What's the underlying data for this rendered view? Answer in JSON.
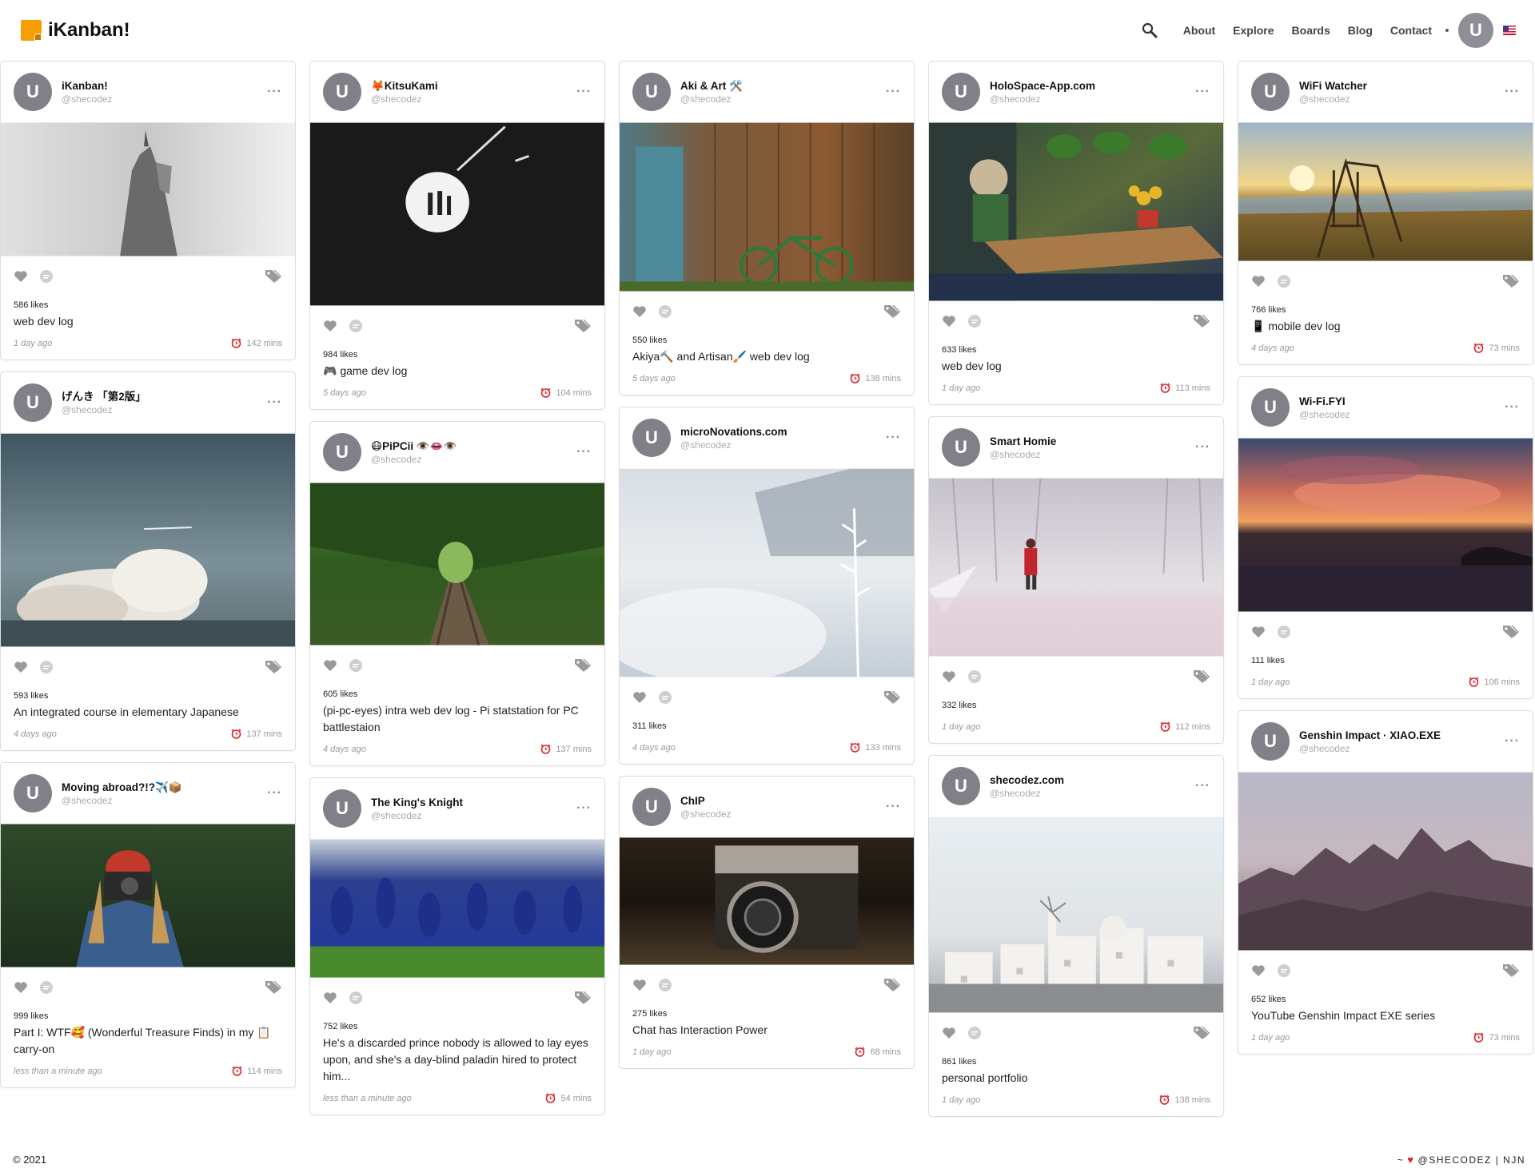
{
  "header": {
    "logo_text": "iKanban!",
    "nav": [
      "About",
      "Explore",
      "Boards",
      "Blog",
      "Contact"
    ],
    "avatar_letter": "U",
    "flag": "us-flag-icon"
  },
  "cards": [
    {
      "name": "iKanban!",
      "handle": "@shecodez",
      "likes": "586 likes",
      "desc": "web dev log",
      "ago": "1 day ago",
      "mins": "142 mins"
    },
    {
      "name": "げんき 「第2版」",
      "handle": "@shecodez",
      "likes": "593 likes",
      "desc": "An integrated course in elementary Japanese",
      "ago": "4 days ago",
      "mins": "137 mins"
    },
    {
      "name": "Moving abroad?!?✈️📦",
      "handle": "@shecodez",
      "likes": "999 likes",
      "desc": "Part I: WTF🥰 (Wonderful Treasure Finds) in my 📋 carry-on",
      "ago": "less than a minute ago",
      "mins": "114 mins"
    },
    {
      "name": "🦊KitsuKami",
      "handle": "@shecodez",
      "likes": "984 likes",
      "desc": "🎮 game dev log",
      "ago": "5 days ago",
      "mins": "104 mins"
    },
    {
      "name": "😷PiPCii 👁️👄👁️",
      "handle": "@shecodez",
      "likes": "605 likes",
      "desc": "(pi-pc-eyes) intra web dev log - Pi statstation for PC battlestaion",
      "ago": "4 days ago",
      "mins": "137 mins"
    },
    {
      "name": "The King's Knight",
      "handle": "@shecodez",
      "likes": "752 likes",
      "desc": "He's a discarded prince nobody is allowed to lay eyes upon, and she's a day-blind paladin hired to protect him...",
      "ago": "less than a minute ago",
      "mins": "54 mins"
    },
    {
      "name": "Aki & Art 🛠️",
      "handle": "@shecodez",
      "likes": "550 likes",
      "desc": "Akiya🔨 and Artisan🖌️ web dev log",
      "ago": "5 days ago",
      "mins": "138 mins"
    },
    {
      "name": "microNovations.com",
      "handle": "@shecodez",
      "likes": "311 likes",
      "desc": "",
      "ago": "4 days ago",
      "mins": "133 mins"
    },
    {
      "name": "ChIP",
      "handle": "@shecodez",
      "likes": "275 likes",
      "desc": "Chat has Interaction Power",
      "ago": "1 day ago",
      "mins": "68 mins"
    },
    {
      "name": "HoloSpace-App.com",
      "handle": "@shecodez",
      "likes": "633 likes",
      "desc": "web dev log",
      "ago": "1 day ago",
      "mins": "113 mins"
    },
    {
      "name": "Smart Homie",
      "handle": "@shecodez",
      "likes": "332 likes",
      "desc": "",
      "ago": "1 day ago",
      "mins": "112 mins"
    },
    {
      "name": "shecodez.com",
      "handle": "@shecodez",
      "likes": "861 likes",
      "desc": "personal portfolio",
      "ago": "1 day ago",
      "mins": "138 mins"
    },
    {
      "name": "WiFi Watcher",
      "handle": "@shecodez",
      "likes": "766 likes",
      "desc": "📱 mobile dev log",
      "ago": "4 days ago",
      "mins": "73 mins"
    },
    {
      "name": "Wi-Fi.FYI",
      "handle": "@shecodez",
      "likes": "111 likes",
      "desc": "",
      "ago": "1 day ago",
      "mins": "106 mins"
    },
    {
      "name": "Genshin Impact · XIAO.EXE",
      "handle": "@shecodez",
      "likes": "652 likes",
      "desc": "YouTube Genshin Impact EXE series",
      "ago": "1 day ago",
      "mins": "73 mins"
    }
  ],
  "footer": {
    "copyright": "© 2021",
    "credit_prefix": "~",
    "credit": "@SHECODEZ | NJN"
  },
  "colors": {
    "accent": "#f5a000",
    "avatar": "#808188",
    "alarm": "#d9262c",
    "icon_gray": "#9a9a9a"
  }
}
